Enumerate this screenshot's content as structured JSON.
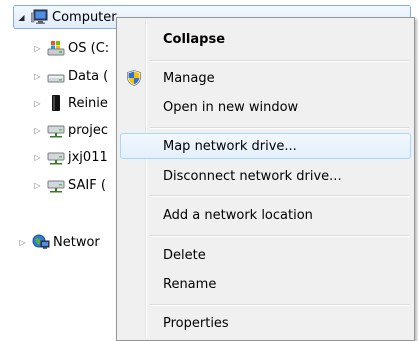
{
  "tree": {
    "root": {
      "label": "Computer",
      "icon": "computer-icon"
    },
    "items": [
      {
        "label": "OS (C:",
        "icon": "system-drive-icon"
      },
      {
        "label": "Data (",
        "icon": "hard-drive-icon"
      },
      {
        "label": "Reinie",
        "icon": "removable-drive-icon"
      },
      {
        "label": "projec",
        "icon": "network-drive-icon"
      },
      {
        "label": "jxj011",
        "icon": "network-drive-icon"
      },
      {
        "label": "SAIF (",
        "icon": "network-drive-icon"
      }
    ],
    "network": {
      "label": "Networ",
      "icon": "network-icon"
    }
  },
  "context_menu": {
    "collapse": "Collapse",
    "manage": "Manage",
    "open_new_window": "Open in new window",
    "map_network_drive": "Map network drive...",
    "disconnect_network_drive": "Disconnect network drive...",
    "add_network_location": "Add a network location",
    "delete": "Delete",
    "rename": "Rename",
    "properties": "Properties",
    "manage_icon": "uac-shield-icon"
  },
  "colors": {
    "menu_background": "#f0f0f0",
    "hover_border": "#a8d8f8",
    "selection_border": "#84acdd"
  }
}
